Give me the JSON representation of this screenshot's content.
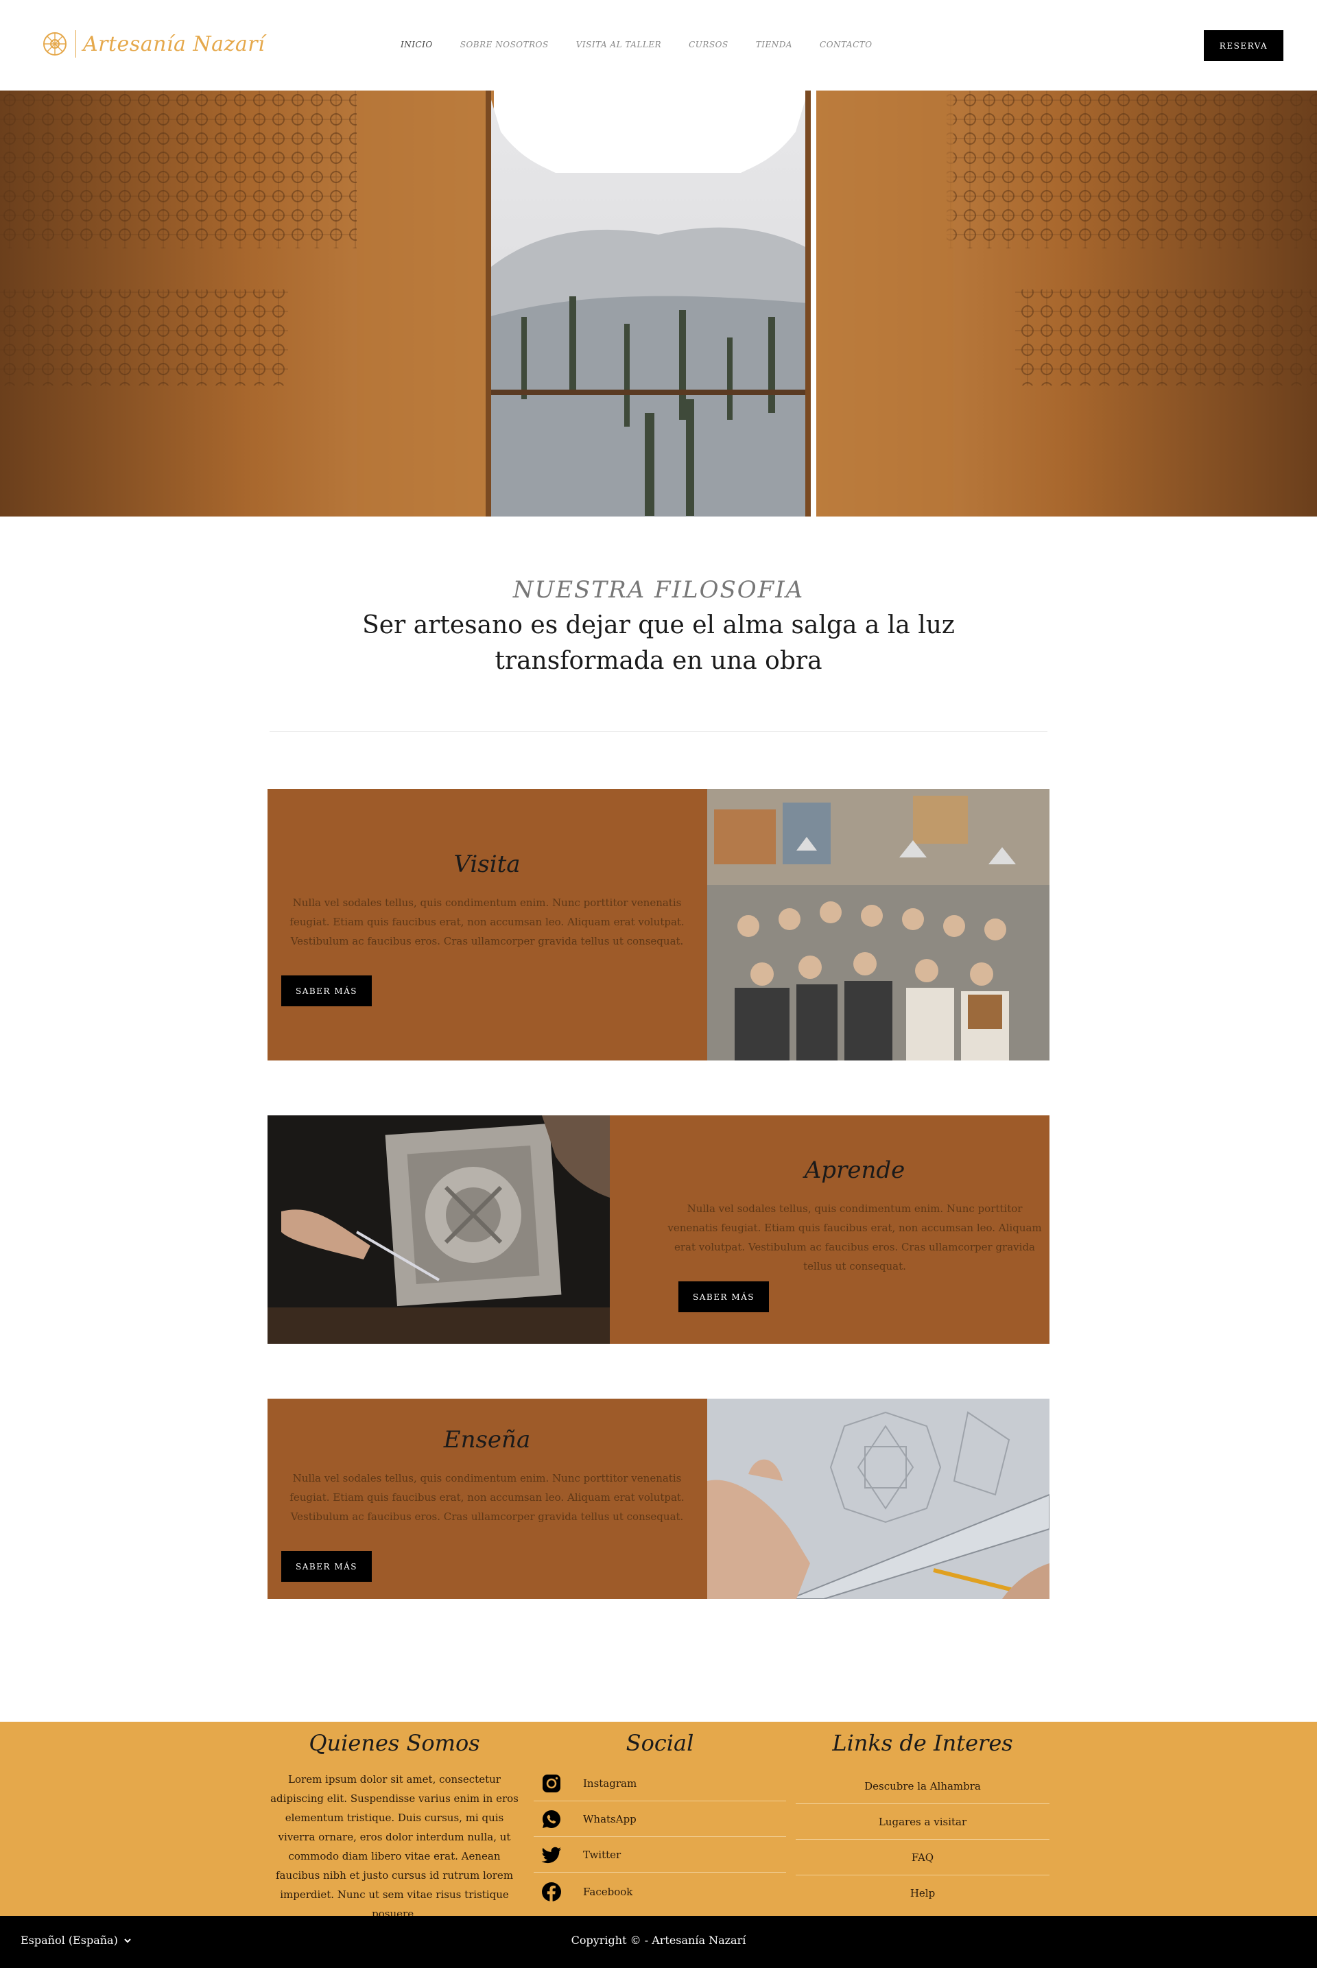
{
  "brand": {
    "name": "Artesanía Nazarí",
    "color": "#e5a84b"
  },
  "nav": {
    "items": [
      {
        "label": "INICIO",
        "active": true
      },
      {
        "label": "SOBRE NOSOTROS",
        "active": false
      },
      {
        "label": "VISITA AL TALLER",
        "active": false
      },
      {
        "label": "CURSOS",
        "active": false
      },
      {
        "label": "TIENDA",
        "active": false
      },
      {
        "label": "CONTACTO",
        "active": false
      }
    ],
    "cta": "RESERVA"
  },
  "philosophy": {
    "kicker": "NUESTRA FILOSOFIA",
    "title_line1": "Ser artesano es dejar que el alma salga a la luz",
    "title_line2": "transformada en una obra"
  },
  "cards": [
    {
      "title": "Visita",
      "body": "Nulla vel sodales tellus, quis condimentum enim. Nunc porttitor venenatis feugiat. Etiam quis faucibus erat, non accumsan leo. Aliquam erat volutpat. Vestibulum ac faucibus eros. Cras ullamcorper gravida tellus ut consequat.",
      "button": "SABER MÁS",
      "image_icon": "workshop-group-photo"
    },
    {
      "title": "Aprende",
      "body": "Nulla vel sodales tellus, quis condimentum enim. Nunc porttitor venenatis feugiat. Etiam quis faucibus erat, non accumsan leo. Aliquam erat volutpat. Vestibulum ac faucibus eros. Cras ullamcorper gravida tellus ut consequat.",
      "button": "SABER MÁS",
      "image_icon": "carving-tile-photo"
    },
    {
      "title": "Enseña",
      "body": "Nulla vel sodales tellus, quis condimentum enim. Nunc porttitor venenatis feugiat. Etiam quis faucibus erat, non accumsan leo. Aliquam erat volutpat. Vestibulum ac faucibus eros. Cras ullamcorper gravida tellus ut consequat.",
      "button": "SABER MÁS",
      "image_icon": "drawing-pattern-photo"
    }
  ],
  "card_color": "#9e5b29",
  "footer": {
    "about_title": "Quienes Somos",
    "about_text": "Lorem ipsum dolor sit amet, consectetur adipiscing elit. Suspendisse varius enim in eros elementum tristique. Duis cursus, mi quis viverra ornare, eros dolor interdum nulla, ut commodo diam libero vitae erat. Aenean faucibus nibh et justo cursus id rutrum lorem imperdiet. Nunc ut sem vitae risus tristique posuere.",
    "social_title": "Social",
    "social": [
      {
        "label": "Instagram",
        "icon": "instagram-icon"
      },
      {
        "label": "WhatsApp",
        "icon": "whatsapp-icon"
      },
      {
        "label": "Twitter",
        "icon": "twitter-icon"
      },
      {
        "label": "Facebook",
        "icon": "facebook-icon"
      }
    ],
    "links_title": "Links de Interes",
    "links": [
      "Descubre la Alhambra",
      "Lugares a visitar",
      "FAQ",
      "Help"
    ],
    "bg_color": "#e5a84b"
  },
  "bottom": {
    "language": "Español (España)",
    "copyright": "Copyright © - Artesanía Nazarí"
  }
}
